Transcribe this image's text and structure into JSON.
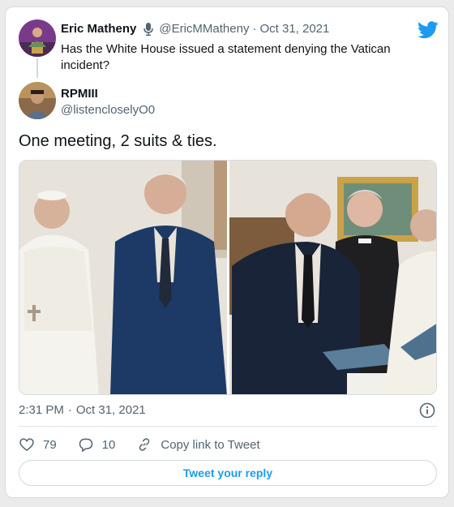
{
  "quoted_tweet": {
    "name": "Eric Matheny",
    "handle": "@EricMMatheny",
    "separator": "·",
    "date": "Oct 31, 2021",
    "text": "Has the White House issued a statement denying the Vatican incident?"
  },
  "tweet": {
    "name": "RPMIII",
    "handle": "@listencloselyO0",
    "text": "One meeting, 2 suits & ties.",
    "time": "2:31 PM",
    "separator": "·",
    "date": "Oct 31, 2021"
  },
  "actions": {
    "likes": "79",
    "replies": "10",
    "copy_link_label": "Copy link to Tweet"
  },
  "reply_button_label": "Tweet your reply",
  "icons": {
    "brand": "twitter-bird-icon",
    "mic": "microphone-icon",
    "info": "info-icon",
    "like": "heart-icon",
    "reply": "reply-bubble-icon",
    "link": "link-icon"
  },
  "colors": {
    "brand": "#1d9bf0",
    "text": "#0f1419",
    "muted": "#536471"
  }
}
